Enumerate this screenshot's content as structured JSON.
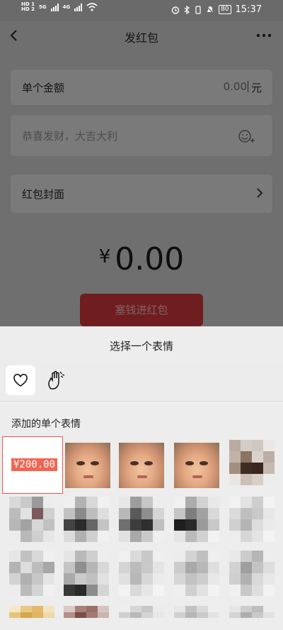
{
  "status_bar": {
    "sim1": "HD 1",
    "sim2": "HD 2",
    "net1": "5G",
    "net2": "4G",
    "battery": "80",
    "time": "15:37"
  },
  "nav": {
    "title": "发红包"
  },
  "form": {
    "amount_label": "单个金额",
    "amount_value": "0.00",
    "amount_unit": "元",
    "greeting_placeholder": "恭喜发财，大吉大利",
    "cover_label": "红包封面"
  },
  "total": {
    "currency": "¥",
    "value": "0.00"
  },
  "submit_label": "塞钱进红包",
  "sheet": {
    "title": "选择一个表情",
    "section_title": "添加的单个表情",
    "selected_sticker_text": "¥200.00"
  },
  "colors": {
    "accent_red": "#f26552",
    "selection_border": "#e6574f",
    "button_red": "#701d1f"
  },
  "icons": [
    "chevron-left-icon",
    "more-icon",
    "emoji-add-icon",
    "chevron-right-icon",
    "heart-icon",
    "clap-hand-icon"
  ]
}
